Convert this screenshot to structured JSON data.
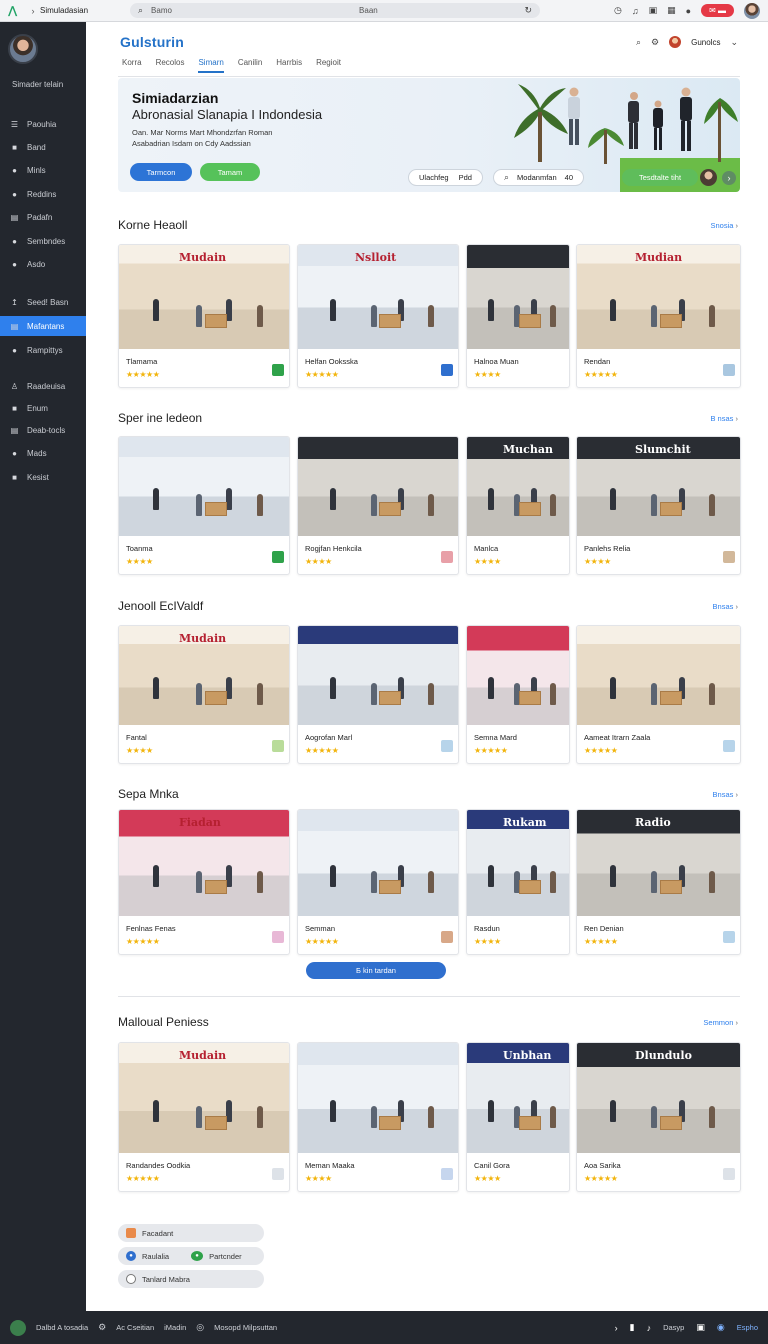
{
  "browser": {
    "title": "Simuladasian",
    "url_left": "Bamo",
    "url_right": "Baan"
  },
  "sidebar": {
    "user_name": "Simader telain",
    "items": [
      {
        "label": "Paouhia",
        "icon": "menu-icon"
      },
      {
        "label": "Band",
        "icon": "square-icon"
      },
      {
        "label": "Minls",
        "icon": "circle-icon"
      },
      {
        "label": "Reddins",
        "icon": "circle-icon"
      },
      {
        "label": "Padafn",
        "icon": "doc-icon"
      },
      {
        "label": "Sembndes",
        "icon": "circle-icon"
      },
      {
        "label": "Asdo",
        "icon": "circle-icon"
      },
      {
        "label": "Seed! Basn",
        "icon": "arrow-icon"
      },
      {
        "label": "Mafantans",
        "icon": "doc-icon"
      },
      {
        "label": "Rampittys",
        "icon": "circle-icon"
      },
      {
        "label": "Raadeuisa",
        "icon": "user-icon"
      },
      {
        "label": "Enum",
        "icon": "square-icon"
      },
      {
        "label": "Deab-tocls",
        "icon": "doc-icon"
      },
      {
        "label": "Mads",
        "icon": "circle-icon"
      },
      {
        "label": "Kesist",
        "icon": "square-icon"
      }
    ],
    "active_index": 8
  },
  "header": {
    "brand": "Gulsturin",
    "user_label": "Gunolcs",
    "tabs": [
      "Korra",
      "Recolos",
      "Simarn",
      "Canilin",
      "Harrbis",
      "Regioit"
    ],
    "active_tab": 2
  },
  "hero": {
    "title": "Simiadarzian",
    "subtitle": "Abronasial Slanapia I Indondesia",
    "line1": "Oan. Mar Norms Mart Mhondzrfan Roman",
    "line2": "Asabadrian Isdam on Cdy Aadssian",
    "btn_primary": "Tarmcon",
    "btn_secondary": "Tamam",
    "pill1_a": "Ulachfeg",
    "pill1_b": "Pdd",
    "pill2_a": "Modanmfan",
    "pill2_b": "40",
    "pill3": "Tesdtalte tiht"
  },
  "sections": [
    {
      "title": "Korne Heaoll",
      "see_all": "Snosia",
      "cards": [
        {
          "name": "Tlamama",
          "stars": "★★★★★",
          "badge_color": "#2fa24a",
          "style": "store-a",
          "sign": "Mudain"
        },
        {
          "name": "Helfan Ooksska",
          "stars": "★★★★★",
          "badge_color": "#2f6fce",
          "style": "store-b",
          "sign": "Nslloit"
        },
        {
          "name": "Halnoa Muan",
          "stars": "★★★★",
          "badge_color": "",
          "style": "store-c",
          "sign": ""
        },
        {
          "name": "Rendan",
          "stars": "★★★★★",
          "badge_color": "#a9c7e0",
          "style": "store-a",
          "sign": "Mudian"
        }
      ]
    },
    {
      "title": "Sper ine ledeon",
      "see_all": "B nsas",
      "cards": [
        {
          "name": "Toanma",
          "stars": "★★★★",
          "badge_color": "#2fa24a",
          "style": "store-b",
          "sign": ""
        },
        {
          "name": "Rogjfan Henkcila",
          "stars": "★★★★",
          "badge_color": "#e8a0a8",
          "style": "store-c",
          "sign": ""
        },
        {
          "name": "Manlca",
          "stars": "★★★★",
          "badge_color": "",
          "style": "store-c",
          "sign": "Muchan"
        },
        {
          "name": "Panlehs Relia",
          "stars": "★★★★",
          "badge_color": "#d2b89a",
          "style": "store-c",
          "sign": "Slumchit"
        }
      ]
    },
    {
      "title": "Jenooll EcIValdf",
      "see_all": "Bnsas",
      "cards": [
        {
          "name": "Fantal",
          "stars": "★★★★",
          "badge_color": "#b9dc9a",
          "style": "store-a",
          "sign": "Mudain"
        },
        {
          "name": "Aogrofan Marl",
          "stars": "★★★★★",
          "badge_color": "#b7d4ea",
          "style": "store-e",
          "sign": ""
        },
        {
          "name": "Semna Mard",
          "stars": "★★★★★",
          "badge_color": "",
          "style": "store-d",
          "sign": ""
        },
        {
          "name": "Aameat Itrarn Zaala",
          "stars": "★★★★★",
          "badge_color": "#b7d4ea",
          "style": "store-a",
          "sign": ""
        }
      ]
    },
    {
      "title": "Sepa Mnka",
      "see_all": "Bnsas",
      "cards": [
        {
          "name": "Fenlnas Fenas",
          "stars": "★★★★★",
          "badge_color": "#e8b8d6",
          "style": "store-d",
          "sign": "Fiadan"
        },
        {
          "name": "Semman",
          "stars": "★★★★★",
          "badge_color": "#d8a888",
          "style": "store-b",
          "sign": ""
        },
        {
          "name": "Rasdun",
          "stars": "★★★★",
          "badge_color": "",
          "style": "store-e",
          "sign": "Rukam"
        },
        {
          "name": "Ren Denian",
          "stars": "★★★★★",
          "badge_color": "#b7d4ea",
          "style": "store-c",
          "sign": "Radio"
        }
      ]
    },
    {
      "title": "Malloual Peniess",
      "see_all": "Semmon",
      "cards": [
        {
          "name": "Randandes Oodkia",
          "stars": "★★★★★",
          "badge_color": "#dde2e8",
          "style": "store-a",
          "sign": "Mudain"
        },
        {
          "name": "Meman Maaka",
          "stars": "★★★★",
          "badge_color": "#c6d6ee",
          "style": "store-b",
          "sign": ""
        },
        {
          "name": "Canil Gora",
          "stars": "★★★★",
          "badge_color": "",
          "style": "store-e",
          "sign": "Unbhan"
        },
        {
          "name": "Aoa Sarika",
          "stars": "★★★★★",
          "badge_color": "#dde2e8",
          "style": "store-c",
          "sign": "Dlundulo"
        }
      ]
    }
  ],
  "show_more": "Б kin tardan",
  "chips": [
    {
      "label": "Facadant",
      "color": "#e98a4a"
    },
    {
      "label": "Raulalia",
      "label2": "Partcnder",
      "color": "#2f6fce",
      "color2": "#2fa24a"
    },
    {
      "label": "Tanlard Mabra",
      "color": "#ffffff"
    }
  ],
  "footer": {
    "left1": "Dalbd A tosadia",
    "left2": "Ac Cseitian",
    "left3": "iMadin",
    "left4": "Mosopd Milpsuttan",
    "right1": "Dasyp",
    "right2": "Espho"
  },
  "colors": {
    "accent": "#2f80ed",
    "sidebar_bg": "#23272e",
    "star": "#f2b40c"
  }
}
